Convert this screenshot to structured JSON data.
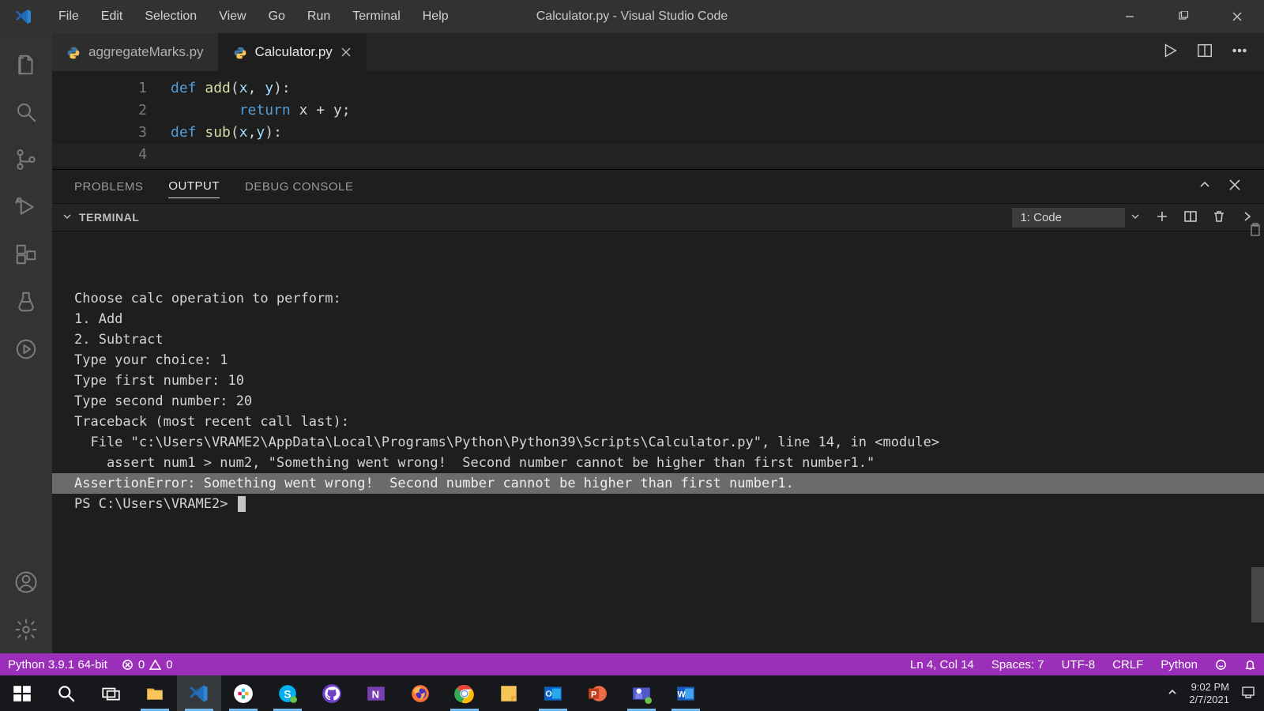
{
  "titlebar": {
    "menu": [
      "File",
      "Edit",
      "Selection",
      "View",
      "Go",
      "Run",
      "Terminal",
      "Help"
    ],
    "title": "Calculator.py - Visual Studio Code"
  },
  "tabs": {
    "items": [
      {
        "label": "aggregateMarks.py",
        "active": false,
        "closeVisible": false
      },
      {
        "label": "Calculator.py",
        "active": true,
        "closeVisible": true
      }
    ]
  },
  "code": {
    "lines": [
      {
        "n": "1",
        "segs": [
          {
            "c": "kw",
            "t": "def "
          },
          {
            "c": "fn",
            "t": "add"
          },
          {
            "c": "tx",
            "t": "("
          },
          {
            "c": "pn",
            "t": "x"
          },
          {
            "c": "tx",
            "t": ", "
          },
          {
            "c": "pn",
            "t": "y"
          },
          {
            "c": "tx",
            "t": "):"
          }
        ]
      },
      {
        "n": "2",
        "segs": [
          {
            "c": "tx",
            "t": "        "
          },
          {
            "c": "kw",
            "t": "return"
          },
          {
            "c": "tx",
            "t": " x + y;"
          }
        ]
      },
      {
        "n": "3",
        "segs": [
          {
            "c": "tx",
            "t": ""
          }
        ]
      },
      {
        "n": "4",
        "segs": [
          {
            "c": "kw",
            "t": "def "
          },
          {
            "c": "fn",
            "t": "sub"
          },
          {
            "c": "tx",
            "t": "("
          },
          {
            "c": "pn",
            "t": "x"
          },
          {
            "c": "tx",
            "t": ","
          },
          {
            "c": "pn",
            "t": "y"
          },
          {
            "c": "tx",
            "t": "):"
          }
        ]
      }
    ]
  },
  "panel": {
    "tabs": [
      "PROBLEMS",
      "OUTPUT",
      "DEBUG CONSOLE"
    ],
    "activeTab": "OUTPUT",
    "terminalLabel": "TERMINAL",
    "terminalSelector": "1: Code",
    "lines": [
      "",
      "Choose calc operation to perform:",
      "1. Add",
      "2. Subtract",
      "Type your choice: 1",
      "Type first number: 10",
      "Type second number: 20",
      "Traceback (most recent call last):",
      "  File \"c:\\Users\\VRAME2\\AppData\\Local\\Programs\\Python\\Python39\\Scripts\\Calculator.py\", line 14, in <module>",
      "    assert num1 > num2, \"Something went wrong!  Second number cannot be higher than first number1.\""
    ],
    "highlighted": "AssertionError: Something went wrong!  Second number cannot be higher than first number1.",
    "prompt": "PS C:\\Users\\VRAME2> "
  },
  "status": {
    "python": "Python 3.9.1 64-bit",
    "errors": "0",
    "warnings": "0",
    "pos": "Ln 4, Col 14",
    "spaces": "Spaces: 7",
    "enc": "UTF-8",
    "eol": "CRLF",
    "lang": "Python"
  },
  "tray": {
    "time": "9:02 PM",
    "date": "2/7/2021"
  }
}
